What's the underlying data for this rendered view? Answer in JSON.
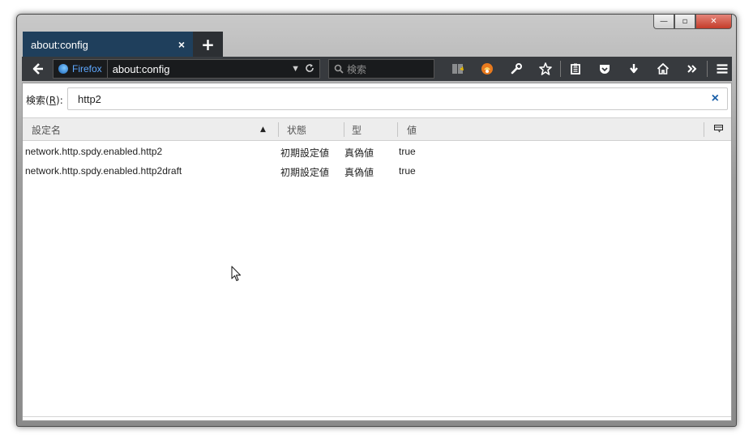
{
  "window": {
    "controls": {
      "minimize": "—",
      "maximize": "▫",
      "close": "✕"
    }
  },
  "tabs": [
    {
      "label": "about:config",
      "close": "×"
    }
  ],
  "newtab_label": "+",
  "navbar": {
    "back": "←",
    "identity_label": "Firefox",
    "url": "about:config",
    "url_dropdown": "▼",
    "url_reload": "C",
    "search_placeholder": "検索"
  },
  "filter": {
    "label_prefix": "検索(",
    "label_accel": "R",
    "label_suffix": "):",
    "value": "http2",
    "clear": "×"
  },
  "columns": {
    "name": "設定名",
    "status": "状態",
    "type": "型",
    "value": "値",
    "sort_indicator": "▲"
  },
  "rows": [
    {
      "name": "network.http.spdy.enabled.http2",
      "status": "初期設定値",
      "type": "真偽値",
      "value": "true"
    },
    {
      "name": "network.http.spdy.enabled.http2draft",
      "status": "初期設定値",
      "type": "真偽値",
      "value": "true"
    }
  ],
  "icons": {
    "toolbar": [
      "barcode-icon",
      "addon-icon",
      "wrench-icon",
      "bookmark-star-icon",
      "reading-list-icon",
      "pocket-icon",
      "download-icon",
      "home-icon",
      "overflow-icon",
      "menu-icon"
    ]
  }
}
